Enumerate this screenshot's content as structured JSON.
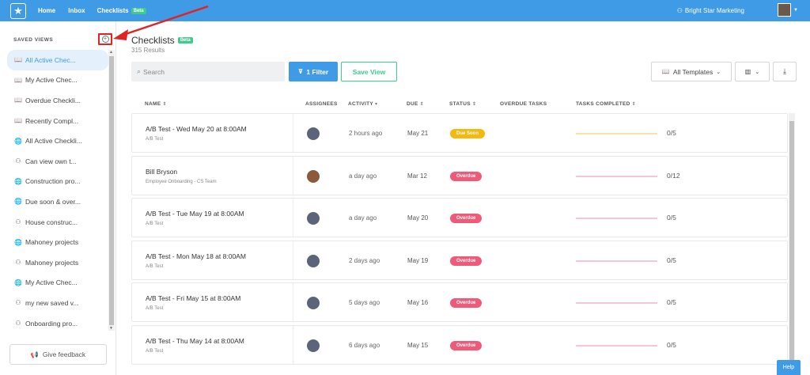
{
  "topbar": {
    "nav": [
      "Home",
      "Inbox",
      "Checklists"
    ],
    "beta_label": "Beta",
    "org_name": "Bright Star Marketing"
  },
  "sidebar": {
    "title": "SAVED VIEWS",
    "items": [
      {
        "label": "All Active Chec...",
        "icon": "book-icon"
      },
      {
        "label": "My Active Chec...",
        "icon": "book-icon"
      },
      {
        "label": "Overdue Checkli...",
        "icon": "book-icon"
      },
      {
        "label": "Recently Compl...",
        "icon": "book-icon"
      },
      {
        "label": "All Active Checkli...",
        "icon": "globe-icon"
      },
      {
        "label": "Can view own t...",
        "icon": "users-icon"
      },
      {
        "label": "Construction pro...",
        "icon": "globe-icon"
      },
      {
        "label": "Due soon & over...",
        "icon": "globe-icon"
      },
      {
        "label": "House construc...",
        "icon": "users-icon"
      },
      {
        "label": "Mahoney projects",
        "icon": "globe-icon"
      },
      {
        "label": "Mahoney projects",
        "icon": "users-icon"
      },
      {
        "label": "My Active Chec...",
        "icon": "globe-icon"
      },
      {
        "label": "my new saved v...",
        "icon": "users-icon"
      },
      {
        "label": "Onboarding pro...",
        "icon": "users-icon"
      }
    ],
    "feedback_label": "Give feedback"
  },
  "main": {
    "title": "Checklists",
    "beta_label": "Beta",
    "results": "315 Results",
    "search_placeholder": "Search",
    "filter_label": "1 Filter",
    "save_view_label": "Save View",
    "templates_label": "All Templates"
  },
  "table": {
    "headers": {
      "name": "NAME",
      "assignees": "ASSIGNEES",
      "activity": "ACTIVITY",
      "due": "DUE",
      "status": "STATUS",
      "overdue": "OVERDUE TASKS",
      "completed": "TASKS COMPLETED"
    },
    "rows": [
      {
        "name": "A/B Test - Wed May 20 at 8:00AM",
        "sub": "A/B Test",
        "activity": "2 hours ago",
        "due": "May 21",
        "status": "Due Soon",
        "count": "0/5"
      },
      {
        "name": "Bill Bryson",
        "sub": "Employee Onboarding - CS Team",
        "activity": "a day ago",
        "due": "Mar 12",
        "status": "Overdue",
        "count": "0/12"
      },
      {
        "name": "A/B Test - Tue May 19 at 8:00AM",
        "sub": "A/B Test",
        "activity": "a day ago",
        "due": "May 20",
        "status": "Overdue",
        "count": "0/5"
      },
      {
        "name": "A/B Test - Mon May 18 at 8:00AM",
        "sub": "A/B Test",
        "activity": "2 days ago",
        "due": "May 19",
        "status": "Overdue",
        "count": "0/5"
      },
      {
        "name": "A/B Test - Fri May 15 at 8:00AM",
        "sub": "A/B Test",
        "activity": "5 days ago",
        "due": "May 16",
        "status": "Overdue",
        "count": "0/5"
      },
      {
        "name": "A/B Test - Thu May 14 at 8:00AM",
        "sub": "A/B Test",
        "activity": "6 days ago",
        "due": "May 15",
        "status": "Overdue",
        "count": "0/5"
      }
    ]
  },
  "help_label": "Help",
  "colors": {
    "brand_blue": "#3f9be6",
    "beta_green": "#3fcb8c",
    "overdue_red": "#ef5a79",
    "due_soon_yellow": "#f5b80c",
    "annotation_red": "#e02424"
  }
}
